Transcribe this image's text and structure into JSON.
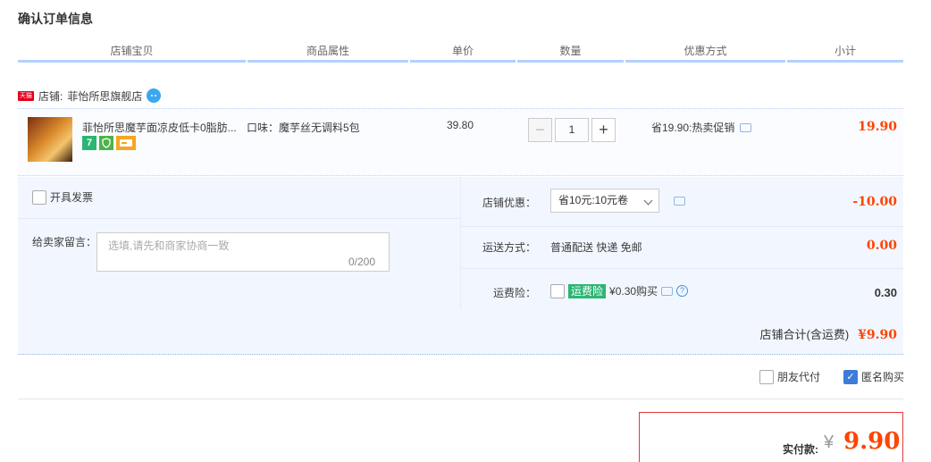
{
  "page": {
    "title": "确认订单信息"
  },
  "columns": [
    "店铺宝贝",
    "商品属性",
    "单价",
    "数量",
    "优惠方式",
    "小计"
  ],
  "shop": {
    "badge": "天猫",
    "label": "店铺:",
    "name": "菲怡所思旗舰店"
  },
  "item": {
    "name": "菲怡所思魔芋面凉皮低卡0脂肪...",
    "badges": [
      "7",
      "",
      ""
    ],
    "attribute": "口味：魔芋丝无调料5包",
    "unit_price": "39.80",
    "quantity": "1",
    "minus": "−",
    "plus": "+",
    "promo": "省19.90:热卖促销",
    "subtotal": "19.90"
  },
  "invoice": {
    "label": "开具发票"
  },
  "message": {
    "label": "给卖家留言：",
    "placeholder": "选填,请先和商家协商一致",
    "count": "0/200"
  },
  "shop_discount": {
    "label": "店铺优惠：",
    "selected": "省10元:10元卷",
    "value": "-10.00"
  },
  "shipping": {
    "label": "运送方式：",
    "method": "普通配送 快递 免邮",
    "value": "0.00"
  },
  "insurance": {
    "label": "运费险：",
    "tag": "运费险",
    "text": "¥0.30购买",
    "help": "?",
    "value": "0.30"
  },
  "shop_total": {
    "label": "店铺合计(含运费)",
    "value": "¥9.90"
  },
  "options": {
    "friend_pay": "朋友代付",
    "anonymous": "匿名购买",
    "anonymous_checked": true
  },
  "payment": {
    "label": "实付款:",
    "currency": "¥",
    "value": "9.90"
  },
  "colors": {
    "price_red": "#ff4400",
    "border_blue": "#b2d1ff",
    "panel_bg": "#f2f7ff",
    "pay_border": "#e4393c"
  }
}
